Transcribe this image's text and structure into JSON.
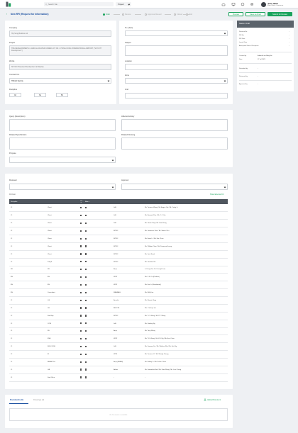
{
  "topbar": {
    "search_placeholder": "Search Site",
    "project_label": "Project",
    "user_name": "John Wick",
    "user_role": "Main Works Contractor"
  },
  "subheader": {
    "back_label": "New RFI (Request for Information)",
    "steps": [
      "Draft",
      "Review",
      "Approved/Issued",
      "Closed",
      "Void"
    ],
    "buttons": {
      "preview": "Preview",
      "save_draft": "Save as Draft",
      "submit": "Submit for Review"
    }
  },
  "form": {
    "company_label": "Company",
    "company_value": "Hip Seng Builders Ltd",
    "project_label": "Project",
    "project_value": "THE DEVELOPMENT in LAND ALLOCATED UNDER LOT NO. 2 HONG KONG INTERNATIONAL AIRPORT (\"SKYCITY Development\")",
    "works_label": "Works",
    "works_value": "SKYGO Proposed Development at SkyCity",
    "contract_label": "Contract No.",
    "contract_value": "TB1GD SkyCity",
    "discipline_label": "Discipline",
    "discipline_boxes": [
      "AR",
      "SE",
      "BS"
    ],
    "to_cc_label": "To / (Attn)",
    "subject_label": "Subject",
    "location_label": "Location",
    "zone_label": "Zone",
    "grid_label": "Grid"
  },
  "query": {
    "description_label": "Query (Description)",
    "affected_activity_label": "Affected Activity",
    "related_specification_label": "Related Specification",
    "related_drawing_label": "Related Drawing",
    "purpose_label": "Purpose"
  },
  "right_panel": {
    "title": "Status: Draft",
    "rows": [
      {
        "label": "Revision No.",
        "value": "-"
      },
      {
        "label": "RFI No.",
        "value": "-"
      },
      {
        "label": "RFI Date",
        "value": "-"
      },
      {
        "label": "Issued Date",
        "value": "-"
      },
      {
        "label": "Anticipated Date of Response",
        "value": "-"
      }
    ],
    "created_by_label": "Created by",
    "created_by_value": "Edward Lam Ming Hin",
    "date_label": "Date",
    "date_value": "17 Jul 2023",
    "submitted_by_label": "Submitted by",
    "reviewed_by_label": "Reviewed by",
    "approved_by_label": "Approved by",
    "dash": "-"
  },
  "distribution": {
    "reviewer_label": "Reviewer",
    "approver_label": "Approver",
    "cc_list_label": "CC List",
    "show_external_label": "Show External CC",
    "columns": [
      "Discipline",
      "CC",
      "Attn",
      "",
      ""
    ],
    "rows": [
      {
        "d": "CI",
        "c": "Client",
        "o": "LAL",
        "p": "Mr. Terence Wong / Mr. Angus Yip / Mr. Cindy Li"
      },
      {
        "d": "CI",
        "c": "Client",
        "o": "LAL",
        "p": "Mr. Bernard Pan / Mr. C.C. Ho"
      },
      {
        "d": "CI",
        "c": "Client",
        "o": "LAL",
        "p": "Mr. Gavin Tang / Mr. Sam Hung"
      },
      {
        "d": "CI",
        "c": "Client",
        "o": "MTRC",
        "p": "Mr. Lawrence Tam / Mr. Simon Chu"
      },
      {
        "d": "CI",
        "c": "Client",
        "o": "MTRC",
        "p": "Mr. Brian Li / Mr. Eric Chan"
      },
      {
        "d": "CI",
        "c": "Client",
        "o": "MTRC",
        "p": "Mr. William Chan / Mr. Desmond Leung"
      },
      {
        "d": "CI",
        "c": "Client",
        "o": "MTRC",
        "p": "Mr. Jack Kwok"
      },
      {
        "d": "CI",
        "c": "DSQS",
        "o": "MTRC",
        "p": "Mr. Jasmine He"
      },
      {
        "d": "SE",
        "c": "SE",
        "o": "Arup",
        "p": "Ir. Fung Chu Ch / Joseph Law"
      },
      {
        "d": "BS",
        "c": "BS",
        "o": "WSP",
        "p": "Mr. K.F. Yiu (Podium)"
      },
      {
        "d": "BS",
        "c": "BS",
        "o": "WSP",
        "p": "Mr. Eric Li (Residential)"
      },
      {
        "d": "BS",
        "c": "Consultant",
        "o": "MAMBALL",
        "p": "Mr. Billy Fan"
      },
      {
        "d": "CI",
        "c": "QS",
        "o": "Arcadis",
        "p": "Mr. Ronnie Tong"
      },
      {
        "d": "CI",
        "c": "LA",
        "o": "AECOM",
        "p": "Ms. Colvey Lam"
      },
      {
        "d": "CI",
        "c": "Site Rep",
        "o": "MTRC",
        "p": "Mr. T.C. Wong / Mr. P.T. Wong"
      },
      {
        "d": "CI",
        "c": "CCM",
        "o": "LAL",
        "p": "Mr. Stanley Ng"
      },
      {
        "d": "CI",
        "c": "FE",
        "o": "Arup",
        "p": "Mr. Tony Wong"
      },
      {
        "d": "CI",
        "c": "RSE",
        "o": "WSP",
        "p": "Mr. T.K. Wong / Mr. K.F. Ng / Mr. Eric Chau"
      },
      {
        "d": "CI",
        "c": "RGE / RSE",
        "o": "LAL",
        "p": "Mr. Sammy Cui / Mr. Wallace Wai / Mr. Eric Ng"
      },
      {
        "d": "CI",
        "c": "EI",
        "o": "WTB",
        "p": "Mr. Terence Yi / Mr. Wendy Cheng"
      },
      {
        "d": "CI",
        "c": "BEAM Plus",
        "o": "Arup (BEAM)",
        "p": "Mr. Bobby Li / Mr. Kelvin Chow"
      },
      {
        "d": "CI",
        "c": "GB",
        "o": "Atkins",
        "p": "Mr. Samantha Bird / Mr. Kam Wong / Mr. Lisa Chung"
      },
      {
        "d": "CI",
        "c": "Site Office",
        "o": "-",
        "p": "-"
      }
    ]
  },
  "documents": {
    "tab_documents": "Documents (0)",
    "tab_drawings": "Drawings (0)",
    "upload_label": "Upload Document",
    "empty_text": "No Document is available"
  }
}
